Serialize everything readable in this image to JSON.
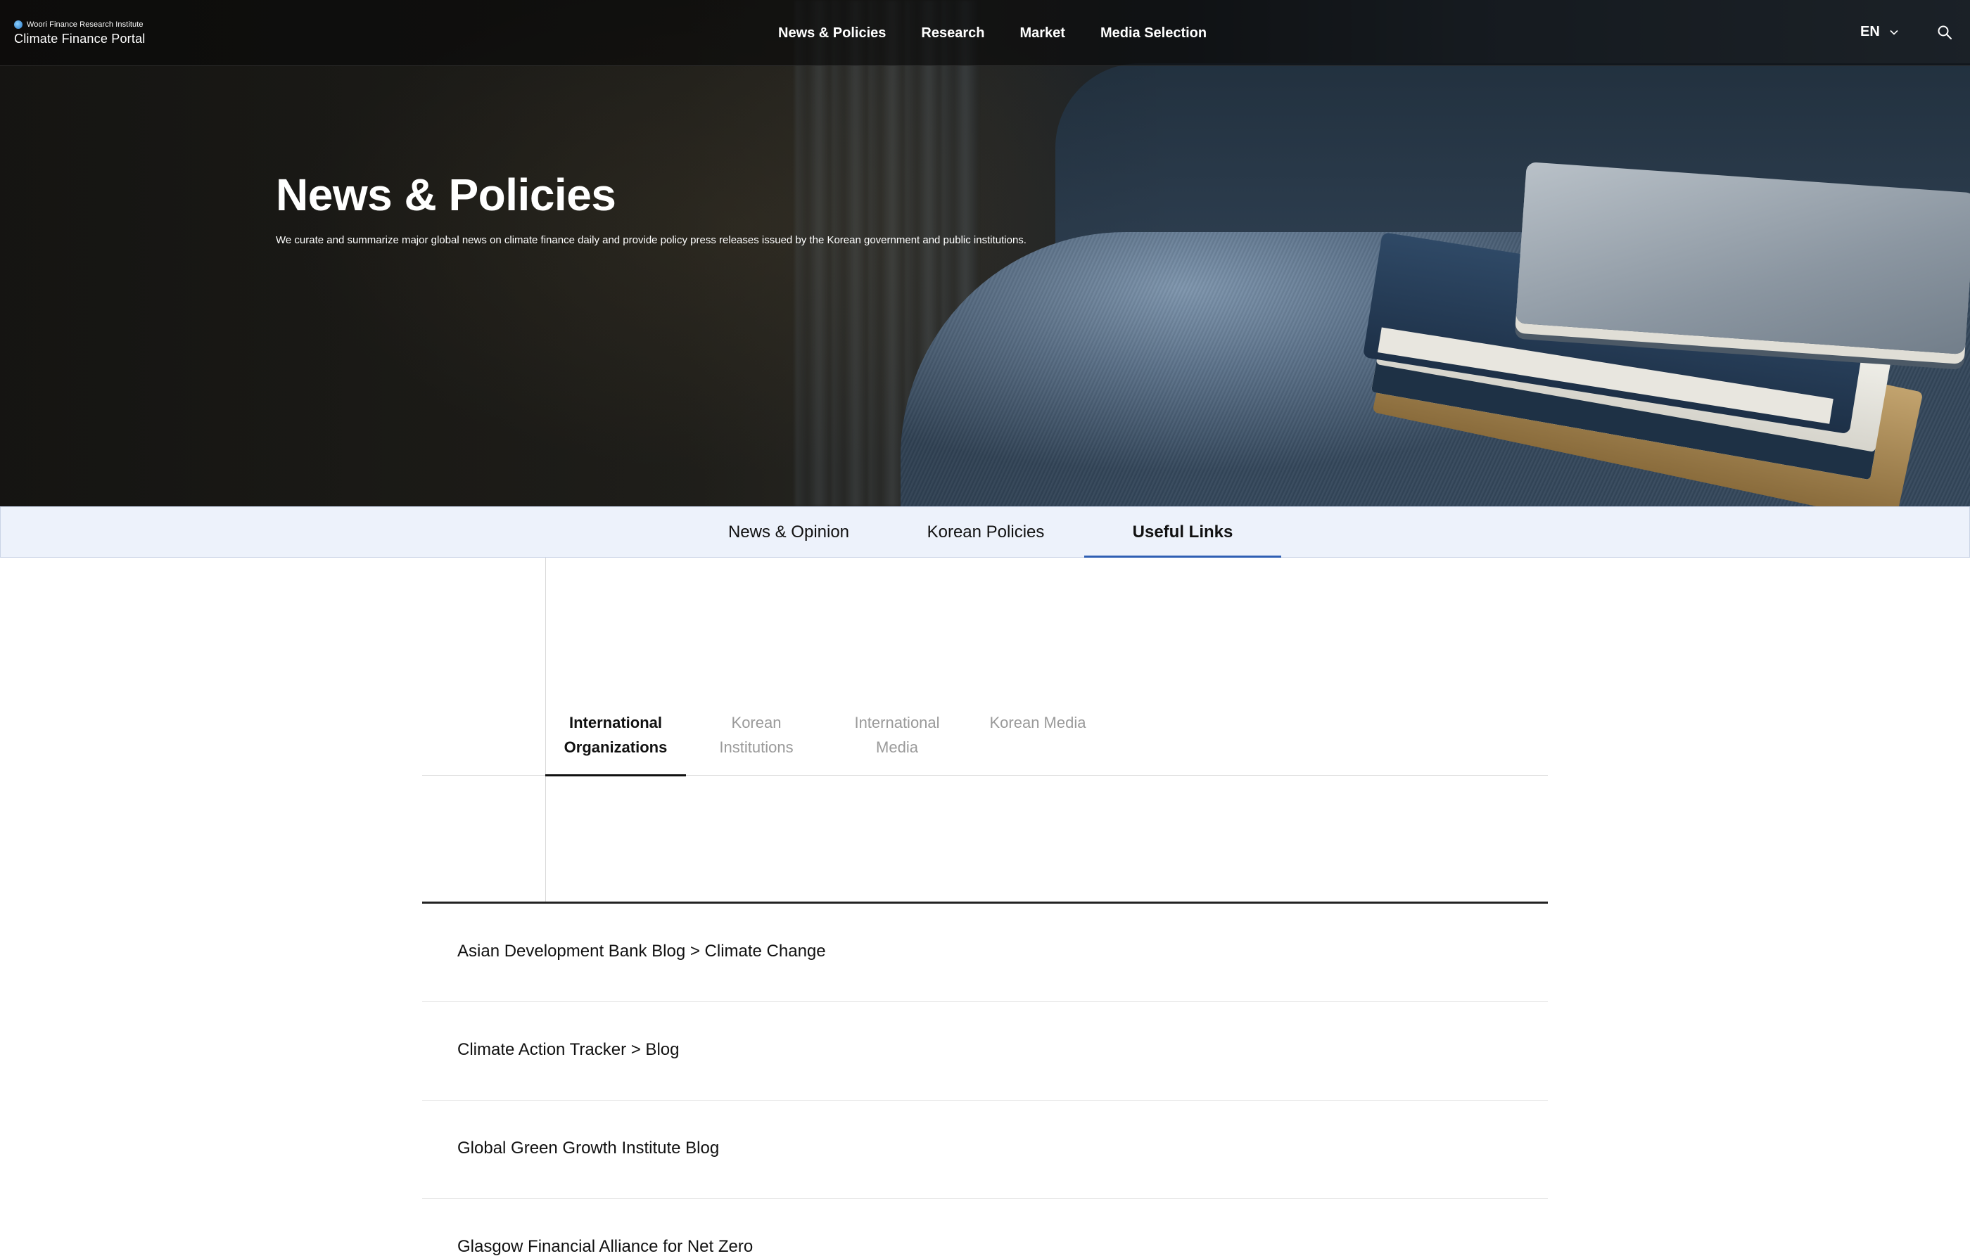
{
  "header": {
    "logo_sub": "Woori Finance Research Institute",
    "logo_main": "Climate Finance Portal",
    "nav": [
      "News & Policies",
      "Research",
      "Market",
      "Media Selection"
    ],
    "language": "EN"
  },
  "hero": {
    "title": "News & Policies",
    "description": "We curate and summarize major global news on climate finance daily and provide policy press releases issued by the Korean government and public institutions."
  },
  "main_tabs": {
    "items": [
      "News & Opinion",
      "Korean Policies",
      "Useful Links"
    ],
    "active": "Useful Links"
  },
  "sub_tabs": {
    "items": [
      {
        "line1": "International",
        "line2": "Organizations"
      },
      {
        "line1": "Korean",
        "line2": "Institutions"
      },
      {
        "line1": "International",
        "line2": "Media"
      },
      {
        "line1": "Korean Media",
        "line2": ""
      }
    ],
    "active": "International Organizations"
  },
  "links": [
    "Asian Development Bank Blog > Climate Change",
    "Climate Action Tracker > Blog",
    "Global Green Growth Institute Blog",
    "Glasgow Financial Alliance for Net Zero"
  ],
  "colors": {
    "accent": "#2f5fb3",
    "tab_bar_bg": "#edf2fb",
    "inactive_text": "#9a9a9a"
  },
  "icons": [
    "logo-globe-icon",
    "chevron-down-icon",
    "search-icon"
  ]
}
